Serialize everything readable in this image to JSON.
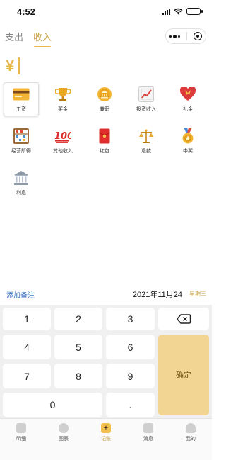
{
  "status_bar": {
    "time": "4:52"
  },
  "header": {
    "tabs": [
      {
        "label": "支出",
        "active": false
      },
      {
        "label": "收入",
        "active": true
      }
    ]
  },
  "amount": {
    "currency_symbol": "¥",
    "value": ""
  },
  "categories": [
    {
      "label": "工资",
      "icon": "credit-card-icon",
      "selected": true
    },
    {
      "label": "奖金",
      "icon": "trophy-icon",
      "selected": false
    },
    {
      "label": "兼职",
      "icon": "bank-coin-icon",
      "selected": false
    },
    {
      "label": "投资收入",
      "icon": "chart-up-icon",
      "selected": false
    },
    {
      "label": "礼金",
      "icon": "heart-ribbon-icon",
      "selected": false
    },
    {
      "label": "经营所得",
      "icon": "abacus-icon",
      "selected": false
    },
    {
      "label": "其他收入",
      "icon": "hundred-points-icon",
      "selected": false
    },
    {
      "label": "红包",
      "icon": "red-envelope-icon",
      "selected": false
    },
    {
      "label": "退款",
      "icon": "balance-scale-icon",
      "selected": false
    },
    {
      "label": "中奖",
      "icon": "medal-icon",
      "selected": false
    },
    {
      "label": "利息",
      "icon": "classical-building-icon",
      "selected": false
    }
  ],
  "notes_row": {
    "add_note_label": "添加备注",
    "date": "2021年11月24",
    "weekday": "星期三"
  },
  "keypad": {
    "keys": [
      "1",
      "2",
      "3",
      "4",
      "5",
      "6",
      "7",
      "8",
      "9",
      "0",
      "."
    ],
    "confirm_label": "确定",
    "backspace_icon": "backspace-icon"
  },
  "bottom_nav": [
    {
      "label": "明细",
      "icon": "list-icon",
      "active": false
    },
    {
      "label": "图表",
      "icon": "pie-chart-icon",
      "active": false
    },
    {
      "label": "记账",
      "icon": "add-icon",
      "active": true
    },
    {
      "label": "消息",
      "icon": "message-icon",
      "active": false
    },
    {
      "label": "我的",
      "icon": "profile-icon",
      "active": false
    }
  ],
  "colors": {
    "accent": "#e8b84b",
    "confirm_bg": "#f2d493",
    "link": "#3c79c6"
  }
}
